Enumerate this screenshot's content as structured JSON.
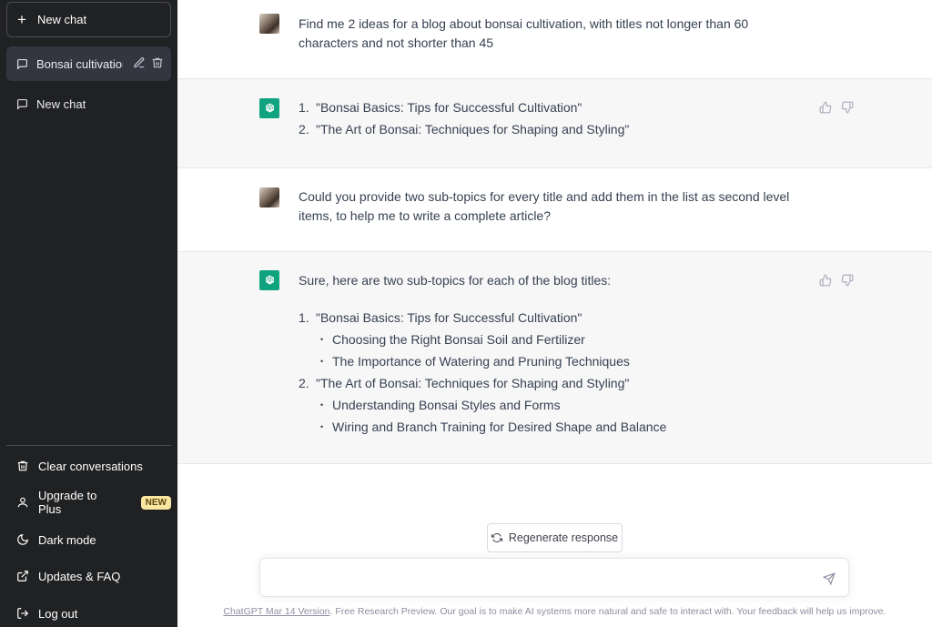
{
  "sidebar": {
    "new_chat": "New chat",
    "conversations": [
      {
        "label": "Bonsai cultivation"
      },
      {
        "label": "New chat"
      }
    ],
    "bottom_items": [
      {
        "label": "Clear conversations",
        "icon": "trash-icon"
      },
      {
        "label": "Upgrade to Plus",
        "icon": "user-icon",
        "badge": "NEW"
      },
      {
        "label": "Dark mode",
        "icon": "moon-icon"
      },
      {
        "label": "Updates & FAQ",
        "icon": "external-link-icon"
      },
      {
        "label": "Log out",
        "icon": "logout-icon"
      }
    ]
  },
  "messages": [
    {
      "role": "user",
      "text": "Find me 2 ideas for a blog about bonsai cultivation, with titles not longer than 60 characters and not shorter than 45"
    },
    {
      "role": "assistant",
      "items": [
        {
          "num": "1.",
          "text": "\"Bonsai Basics: Tips for Successful Cultivation\""
        },
        {
          "num": "2.",
          "text": "\"The Art of Bonsai: Techniques for Shaping and Styling\""
        }
      ]
    },
    {
      "role": "user",
      "text": "Could you provide two sub-topics for every title and add them in the list as second level items, to help me to write a complete article?"
    },
    {
      "role": "assistant",
      "intro": "Sure, here are two sub-topics for each of the blog titles:",
      "items": [
        {
          "num": "1.",
          "text": "\"Bonsai Basics: Tips for Successful Cultivation\"",
          "sub": [
            "Choosing the Right Bonsai Soil and Fertilizer",
            "The Importance of Watering and Pruning Techniques"
          ]
        },
        {
          "num": "2.",
          "text": "\"The Art of Bonsai: Techniques for Shaping and Styling\"",
          "sub": [
            "Understanding Bonsai Styles and Forms",
            "Wiring and Branch Training for Desired Shape and Balance"
          ]
        }
      ]
    }
  ],
  "regenerate": "Regenerate response",
  "input": {
    "placeholder": ""
  },
  "footer": {
    "link": "ChatGPT Mar 14 Version",
    "text": ". Free Research Preview. Our goal is to make AI systems more natural and safe to interact with. Your feedback will help us improve."
  },
  "colors": {
    "sidebar_bg": "#202123",
    "accent": "#10a37f",
    "assistant_bg": "#f7f7f8"
  }
}
